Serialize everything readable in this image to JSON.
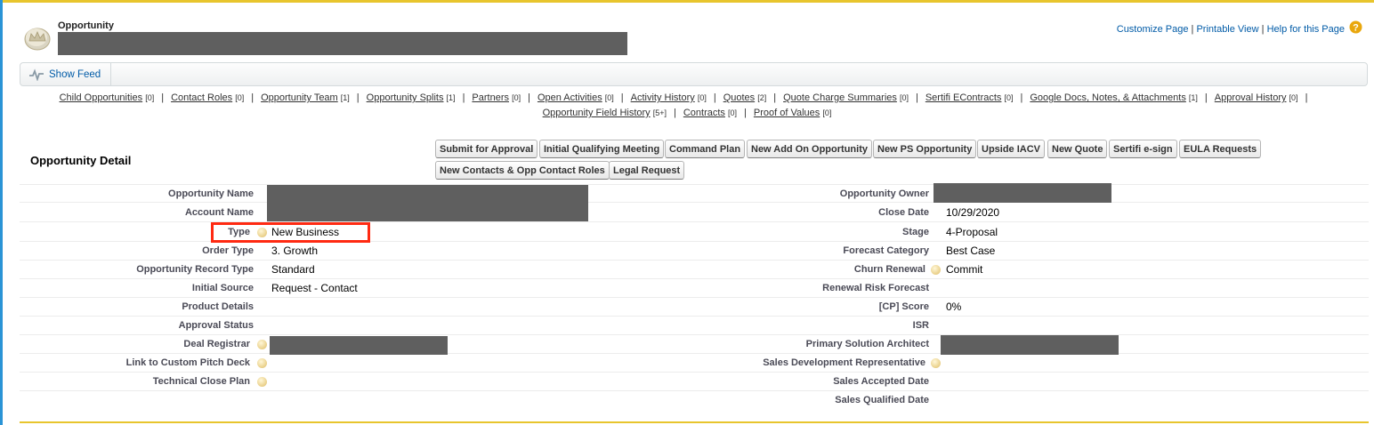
{
  "header": {
    "object_type": "Opportunity",
    "links": [
      "Customize Page",
      "Printable View",
      "Help for this Page"
    ],
    "separator": "|"
  },
  "feed": {
    "label": "Show Feed"
  },
  "related_lists": {
    "row1": [
      {
        "label": "Child Opportunities",
        "count": "[0]"
      },
      {
        "label": "Contact Roles",
        "count": "[0]"
      },
      {
        "label": "Opportunity Team",
        "count": "[1]"
      },
      {
        "label": "Opportunity Splits",
        "count": "[1]"
      },
      {
        "label": "Partners",
        "count": "[0]"
      },
      {
        "label": "Open Activities",
        "count": "[0]"
      },
      {
        "label": "Activity History",
        "count": "[0]"
      },
      {
        "label": "Quotes",
        "count": "[2]"
      },
      {
        "label": "Quote Charge Summaries",
        "count": "[0]"
      },
      {
        "label": "Sertifi EContracts",
        "count": "[0]"
      },
      {
        "label": "Google Docs, Notes, & Attachments",
        "count": "[1]"
      },
      {
        "label": "Approval History",
        "count": "[0]"
      }
    ],
    "row2": [
      {
        "label": "Opportunity Field History",
        "count": "[5+]"
      },
      {
        "label": "Contracts",
        "count": "[0]"
      },
      {
        "label": "Proof of Values",
        "count": "[0]"
      }
    ]
  },
  "detail": {
    "title": "Opportunity Detail",
    "buttons": {
      "submit": "Submit for Approval",
      "initial_meeting": "Initial Qualifying Meeting",
      "command_plan": "Command Plan",
      "new_add_on": "New Add On Opportunity",
      "new_ps": "New PS Opportunity",
      "upside": "Upside IACV",
      "new_quote": "New Quote",
      "sertifi": "Sertifi e-sign",
      "eula": "EULA Requests",
      "new_contacts": "New Contacts & Opp Contact Roles",
      "legal": "Legal Request"
    },
    "left": {
      "opportunity_name": {
        "label": "Opportunity Name",
        "value": ""
      },
      "account_name": {
        "label": "Account Name",
        "value": ""
      },
      "type": {
        "label": "Type",
        "value": "New Business"
      },
      "order_type": {
        "label": "Order Type",
        "value": "3. Growth"
      },
      "record_type": {
        "label": "Opportunity Record Type",
        "value": "Standard"
      },
      "initial_source": {
        "label": "Initial Source",
        "value": "Request - Contact"
      },
      "product_details": {
        "label": "Product Details",
        "value": ""
      },
      "approval_status": {
        "label": "Approval Status",
        "value": ""
      },
      "deal_registrar": {
        "label": "Deal Registrar",
        "value": ""
      },
      "pitch_deck": {
        "label": "Link to Custom Pitch Deck",
        "value": ""
      },
      "tech_close": {
        "label": "Technical Close Plan",
        "value": ""
      }
    },
    "right": {
      "owner": {
        "label": "Opportunity Owner",
        "value": ""
      },
      "close_date": {
        "label": "Close Date",
        "value": "10/29/2020"
      },
      "stage": {
        "label": "Stage",
        "value": "4-Proposal"
      },
      "forecast": {
        "label": "Forecast Category",
        "value": "Best Case"
      },
      "churn": {
        "label": "Churn Renewal",
        "value": "Commit"
      },
      "renewal_risk": {
        "label": "Renewal Risk Forecast",
        "value": ""
      },
      "cp_score": {
        "label": "[CP] Score",
        "value": "0%"
      },
      "isr": {
        "label": "ISR",
        "value": ""
      },
      "architect": {
        "label": "Primary Solution Architect",
        "value": ""
      },
      "sdr": {
        "label": "Sales Development Representative",
        "value": ""
      },
      "sad": {
        "label": "Sales Accepted Date",
        "value": ""
      },
      "sqd": {
        "label": "Sales Qualified Date",
        "value": ""
      }
    }
  },
  "colors": {
    "accent_top": "#e8c52d",
    "accent_left": "#2a94d6",
    "link": "#015ba7",
    "highlight": "#ff2a12"
  }
}
